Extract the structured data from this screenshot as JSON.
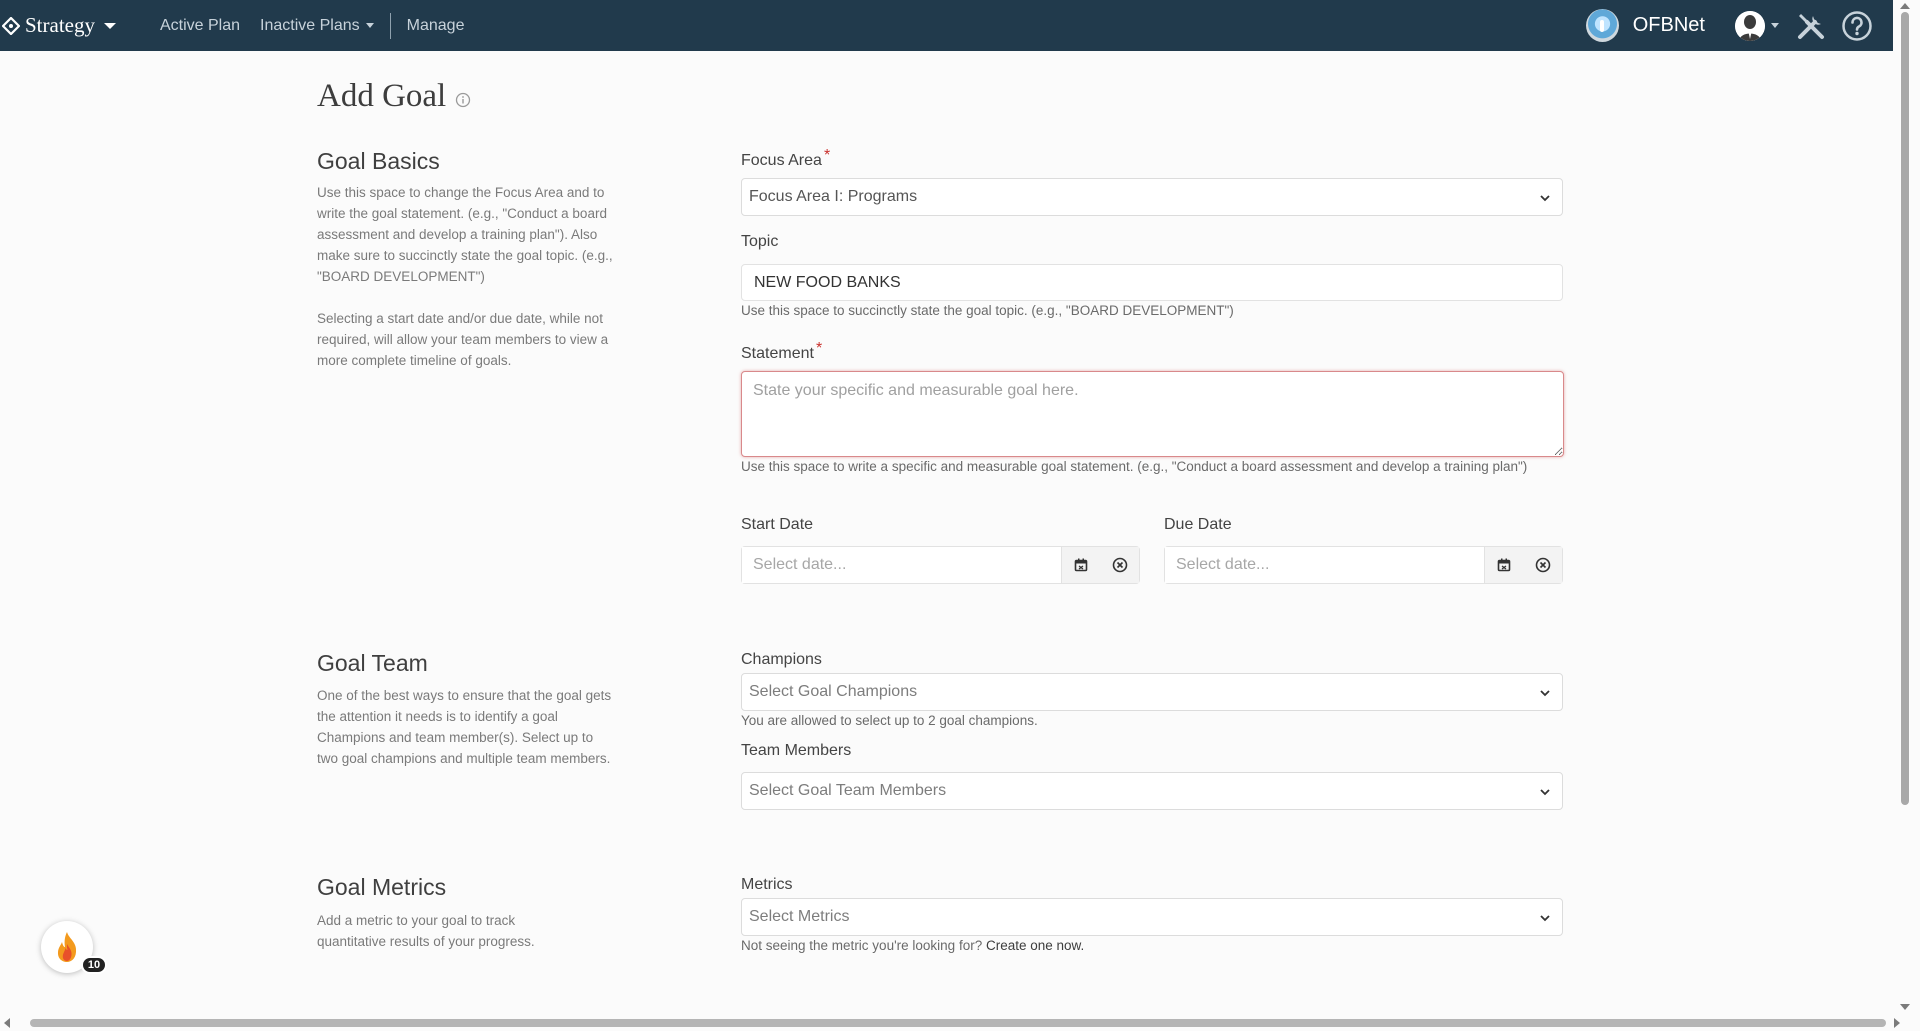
{
  "navbar": {
    "brand": "Strategy",
    "active_plan": "Active Plan",
    "inactive_plans": "Inactive Plans",
    "manage": "Manage",
    "org_name": "OFBNet",
    "colors": {
      "background": "#213a4c"
    }
  },
  "page": {
    "title": "Add Goal"
  },
  "basics": {
    "title": "Goal Basics",
    "desc1": "Use this space to change the Focus Area and to write the goal statement. (e.g., \"Conduct a board assessment and develop a training plan\"). Also make sure to succinctly state the goal topic. (e.g., \"BOARD DEVELOPMENT\")",
    "desc2": "Selecting a start date and/or due date, while not required, will allow your team members to view a more complete timeline of goals."
  },
  "focus_area": {
    "label": "Focus Area",
    "required_mark": "*",
    "value": "Focus Area I: Programs"
  },
  "topic": {
    "label": "Topic",
    "value": "NEW FOOD BANKS",
    "help": "Use this space to succinctly state the goal topic. (e.g., \"BOARD DEVELOPMENT\")"
  },
  "statement": {
    "label": "Statement",
    "required_mark": "*",
    "placeholder": "State your specific and measurable goal here.",
    "help": "Use this space to write a specific and measurable goal statement. (e.g., \"Conduct a board assessment and develop a training plan\")"
  },
  "start_date": {
    "label": "Start Date",
    "placeholder": "Select date..."
  },
  "due_date": {
    "label": "Due Date",
    "placeholder": "Select date..."
  },
  "team": {
    "title": "Goal Team",
    "desc": "One of the best ways to ensure that the goal gets the attention it needs is to identify a goal Champions and team member(s). Select up to two goal champions and multiple team members."
  },
  "champions": {
    "label": "Champions",
    "placeholder": "Select Goal Champions",
    "help": "You are allowed to select up to 2 goal champions."
  },
  "team_members": {
    "label": "Team Members",
    "placeholder": "Select Goal Team Members"
  },
  "metrics_section": {
    "title": "Goal Metrics",
    "desc": "Add a metric to your goal to track quantitative results of your progress."
  },
  "metrics": {
    "label": "Metrics",
    "placeholder": "Select Metrics",
    "help_prefix": "Not seeing the metric you're looking for?",
    "help_link": "Create one now."
  },
  "badge": {
    "count": "10",
    "icon": "fire-icon"
  }
}
